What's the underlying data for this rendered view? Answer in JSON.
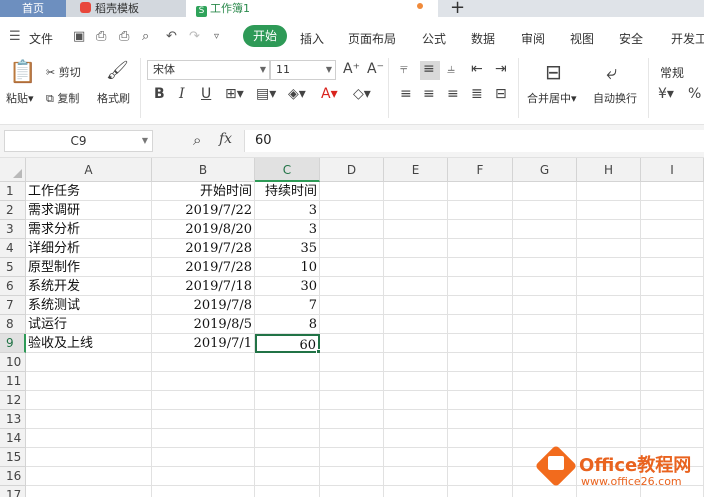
{
  "tabs": {
    "home": "首页",
    "daoke": "稻壳模板",
    "book_icon": "S",
    "book": "工作簿1",
    "plus": "+"
  },
  "menu": {
    "file": "文件",
    "start": "开始",
    "items": [
      "插入",
      "页面布局",
      "公式",
      "数据",
      "审阅",
      "视图",
      "安全",
      "开发工"
    ]
  },
  "ribbon": {
    "paste": "粘贴",
    "cut": "剪切",
    "copy": "复制",
    "format_painter": "格式刷",
    "font_name": "宋体",
    "font_size": "11",
    "bold": "B",
    "italic": "I",
    "underline": "U",
    "merge_center": "合并居中",
    "wrap_text": "自动换行",
    "number_format": "常规"
  },
  "formula_bar": {
    "name_box": "C9",
    "fx": "fx",
    "value": "60"
  },
  "sheet": {
    "columns": [
      "A",
      "B",
      "C",
      "D",
      "E",
      "F",
      "G",
      "H",
      "I"
    ],
    "active_column": "C",
    "active_row": 9,
    "rows": [
      "1",
      "2",
      "3",
      "4",
      "5",
      "6",
      "7",
      "8",
      "9",
      "10",
      "11",
      "12",
      "13",
      "14",
      "15",
      "16",
      "17"
    ],
    "data": [
      {
        "a": "工作任务",
        "b": "开始时间",
        "c": "持续时间"
      },
      {
        "a": "需求调研",
        "b": "2019/7/22",
        "c": "3"
      },
      {
        "a": "需求分析",
        "b": "2019/8/20",
        "c": "3"
      },
      {
        "a": "详细分析",
        "b": "2019/7/28",
        "c": "35"
      },
      {
        "a": "原型制作",
        "b": "2019/7/28",
        "c": "10"
      },
      {
        "a": "系统开发",
        "b": "2019/7/18",
        "c": "30"
      },
      {
        "a": "系统测试",
        "b": "2019/7/8",
        "c": "7"
      },
      {
        "a": "试运行",
        "b": "2019/8/5",
        "c": "8"
      },
      {
        "a": "验收及上线",
        "b": "2019/7/1",
        "c": "60"
      }
    ]
  },
  "watermark": {
    "title": "Office教程网",
    "url": "www.office26.com"
  },
  "colors": {
    "accent_green": "#2e9a57",
    "selection_green": "#217346",
    "watermark_orange": "#e9631f"
  }
}
